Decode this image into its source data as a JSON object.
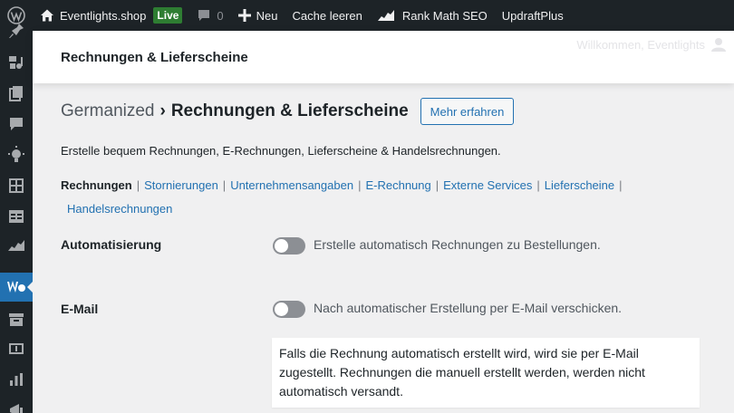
{
  "adminbar": {
    "site_name": "Eventlights.shop",
    "live_badge": "Live",
    "comments_count": "0",
    "new_label": "Neu",
    "cache_label": "Cache leeren",
    "rankmath_label": "Rank Math SEO",
    "updraft_label": "UpdraftPlus"
  },
  "header": {
    "title": "Rechnungen & Lieferscheine",
    "welcome": "Willkommen, Eventlights"
  },
  "page": {
    "breadcrumb_parent": "Germanized",
    "breadcrumb_sep": "›",
    "breadcrumb_current": "Rechnungen & Lieferscheine",
    "more_button": "Mehr erfahren",
    "description": "Erstelle bequem Rechnungen, E-Rechnungen, Lieferscheine & Handelsrechnungen."
  },
  "subnav": {
    "items": [
      "Rechnungen",
      "Stornierungen",
      "Unternehmensangaben",
      "E-Rechnung",
      "Externe Services",
      "Lieferscheine",
      "Handelsrechnungen"
    ],
    "separator": "|"
  },
  "settings": {
    "automation": {
      "label": "Automatisierung",
      "toggle_text": "Erstelle automatisch Rechnungen zu Bestellungen.",
      "enabled": false
    },
    "email": {
      "label": "E-Mail",
      "toggle_text": "Nach automatischer Erstellung per E-Mail verschicken.",
      "enabled": false,
      "help": "Falls die Rechnung automatisch erstellt wird, wird sie per E-Mail zugestellt. Rechnungen die manuell erstellt werden, werden nicht automatisch versandt."
    }
  },
  "colors": {
    "adminbar_bg": "#1d2327",
    "accent": "#2271b1",
    "live_green": "#2e7d32"
  }
}
